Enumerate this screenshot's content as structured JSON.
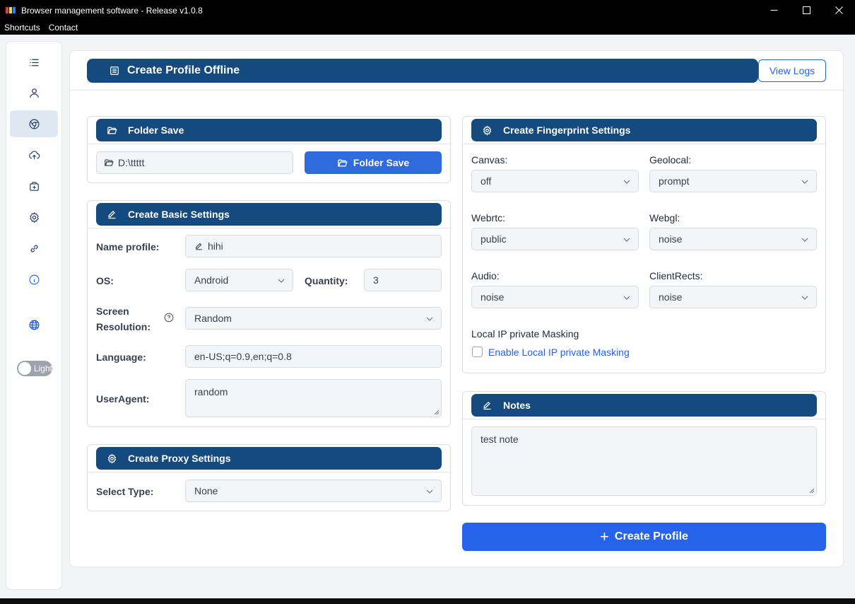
{
  "window": {
    "title": "Browser management software - Release v1.0.8",
    "menu": [
      "Shortcuts",
      "Contact"
    ]
  },
  "sidebar": {
    "icons": [
      "menu-icon",
      "user-icon",
      "chrome-icon",
      "cloud-upload-icon",
      "package-add-icon",
      "settings-icon",
      "link-icon",
      "info-icon",
      "globe-icon"
    ],
    "active": "chrome-icon",
    "theme_toggle_label": "Light"
  },
  "header": {
    "title": "Create Profile Offline",
    "view_logs": "View Logs"
  },
  "folder": {
    "title": "Folder Save",
    "path": "D:\\ttttt",
    "button": "Folder Save"
  },
  "basic": {
    "title": "Create Basic Settings",
    "name_label": "Name profile:",
    "name_value": "hihi",
    "os_label": "OS:",
    "os_value": "Android",
    "quantity_label": "Quantity:",
    "quantity_value": "3",
    "screen_label_1": "Screen",
    "screen_label_2": "Resolution:",
    "screen_value": "Random",
    "language_label": "Language:",
    "language_value": "en-US;q=0.9,en;q=0.8",
    "useragent_label": "UserAgent:",
    "useragent_value": "random"
  },
  "proxy": {
    "title": "Create Proxy Settings",
    "type_label": "Select Type:",
    "type_value": "None"
  },
  "fingerprint": {
    "title": "Create Fingerprint Settings",
    "canvas_label": "Canvas:",
    "canvas_value": "off",
    "geolocal_label": "Geolocal:",
    "geolocal_value": "prompt",
    "webrtc_label": "Webrtc:",
    "webrtc_value": "public",
    "webgl_label": "Webgl:",
    "webgl_value": "noise",
    "audio_label": "Audio:",
    "audio_value": "noise",
    "clientrects_label": "ClientRects:",
    "clientrects_value": "noise",
    "local_ip_label": "Local IP private Masking",
    "local_ip_checkbox": "Enable Local IP private Masking",
    "local_ip_checked": false
  },
  "notes": {
    "title": "Notes",
    "value": "test note"
  },
  "create_button": "Create Profile",
  "colors": {
    "header_blue": "#154a7e",
    "button_blue": "#2563eb",
    "link_blue": "#2563eb"
  }
}
